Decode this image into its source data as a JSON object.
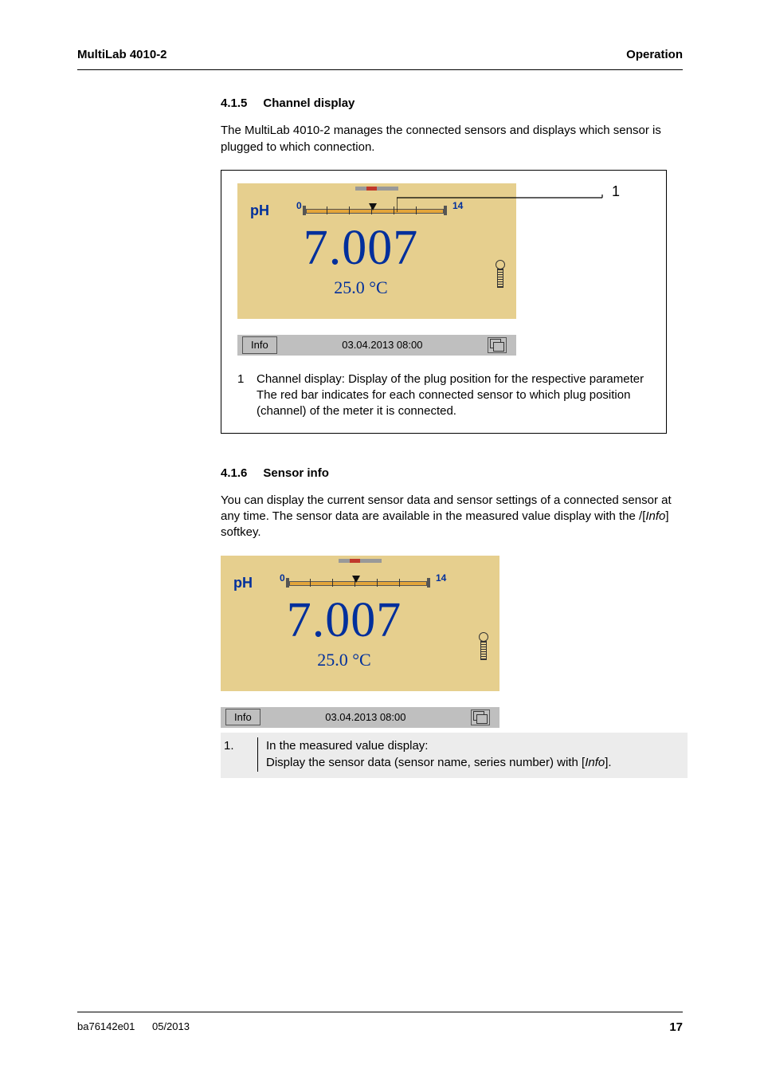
{
  "header": {
    "left": "MultiLab 4010-2",
    "right": "Operation"
  },
  "sec1": {
    "num": "4.1.5",
    "title": "Channel display",
    "p1": "The MultiLab 4010-2 manages the connected sensors and displays which sensor is plugged to which connection."
  },
  "lcd": {
    "param": "pH",
    "scale_min": "0",
    "scale_max": "14",
    "value": "7.007",
    "temp": "25.0 °C",
    "softkey": "Info",
    "datetime": "03.04.2013 08:00"
  },
  "callout": {
    "n1": "1"
  },
  "legend1": {
    "n": "1",
    "l1": "Channel display: Display of the plug position for the respective parameter",
    "l2": "The red bar indicates for each connected sensor to which plug position (channel) of the meter it is connected."
  },
  "sec2": {
    "num": "4.1.6",
    "title": "Sensor info",
    "p1a": "You can display the current sensor data and sensor settings of a connected sensor at any time. The sensor data are available in the measured value display with the /[",
    "p1b": "Info",
    "p1c": "] softkey."
  },
  "step1": {
    "no": "1.",
    "a": "In the measured value display:",
    "b": "Display the sensor data (sensor name, series number) with [",
    "c": "Info",
    "d": "]."
  },
  "footer": {
    "doc": "ba76142e01",
    "date": "05/2013",
    "page": "17"
  }
}
